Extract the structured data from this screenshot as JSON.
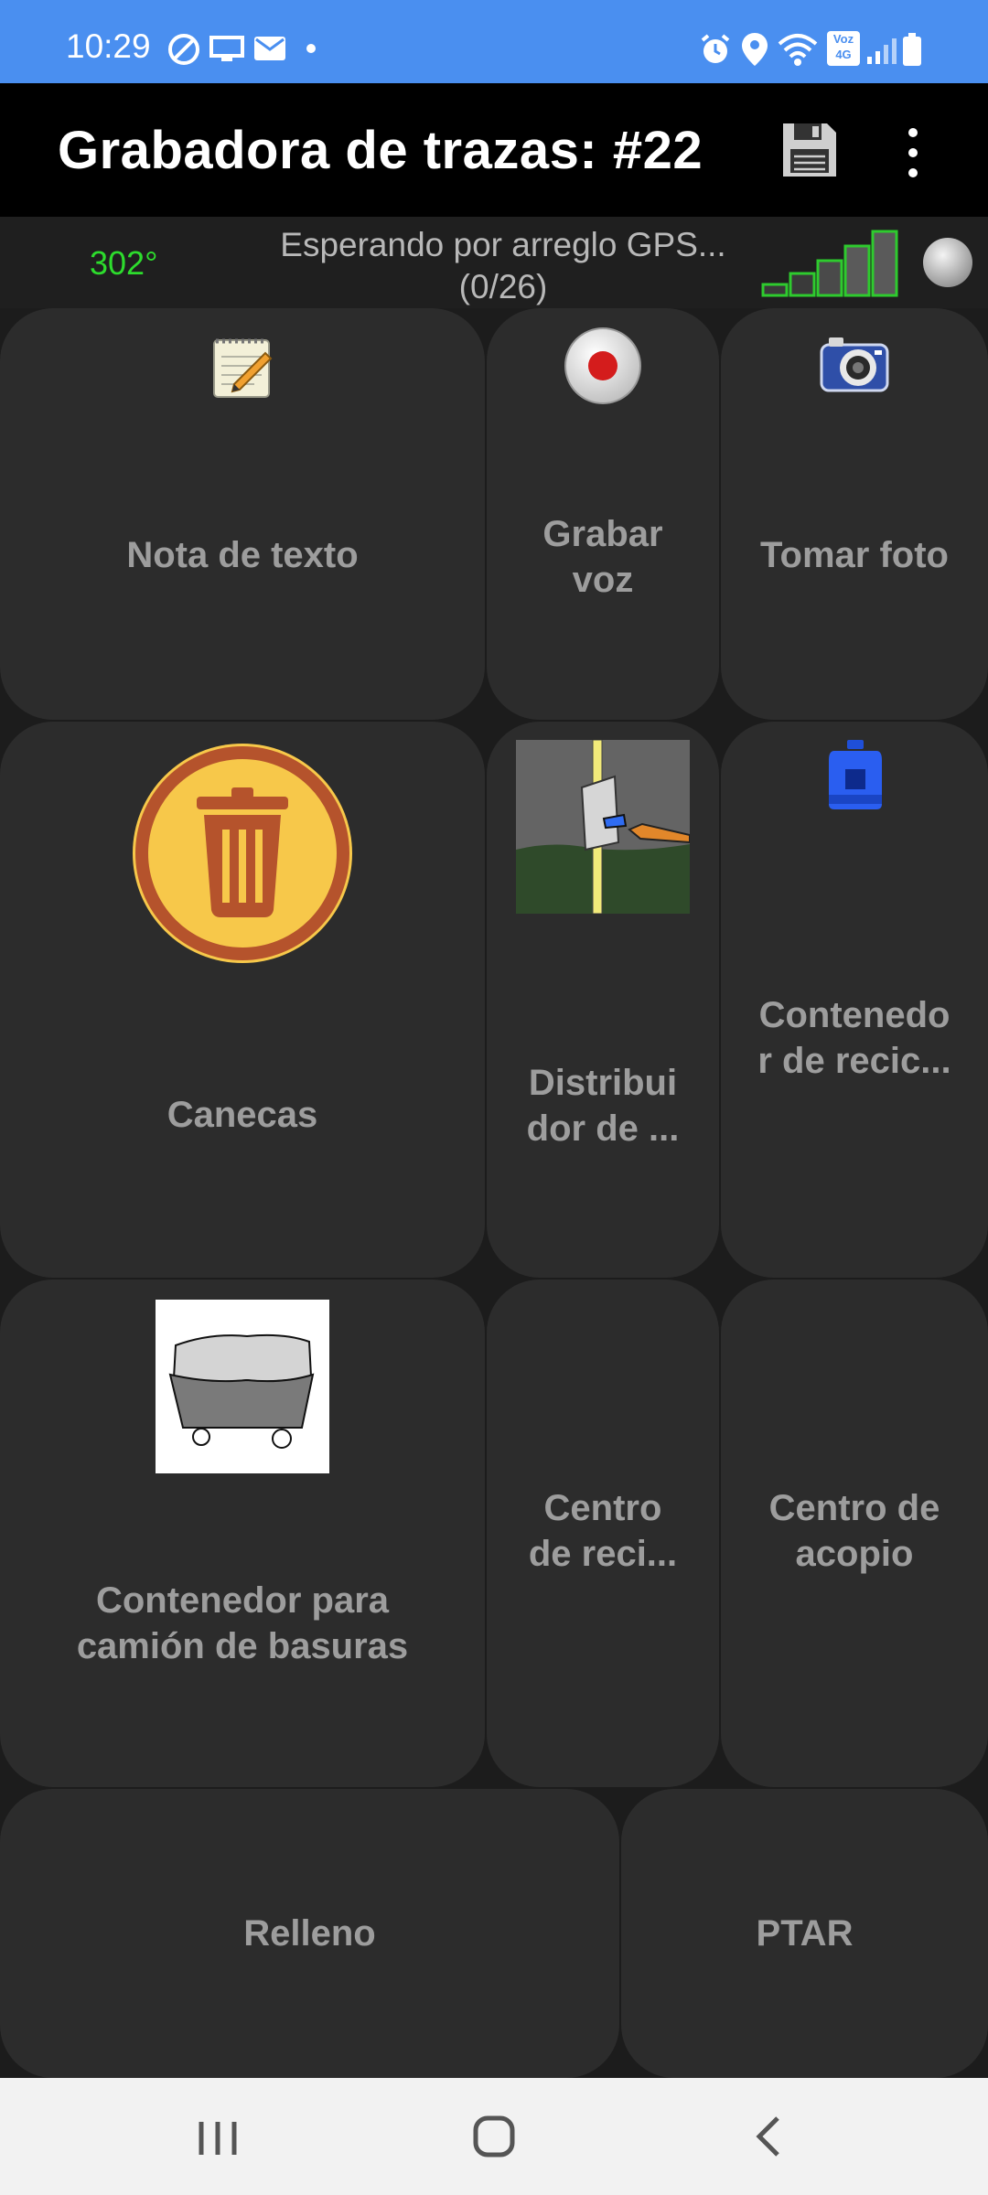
{
  "status_bar": {
    "time": "10:29",
    "left_icons": [
      "missed-call-icon",
      "screen-cast-icon",
      "mail-icon",
      "dot-icon"
    ],
    "right_icons": [
      "alarm-icon",
      "location-icon",
      "wifi-icon",
      "volte-icon",
      "signal-icon",
      "battery-icon"
    ],
    "volte_label": "Voz 4G"
  },
  "app_bar": {
    "title": "Grabadora de trazas: #22",
    "save_icon": "save-icon",
    "more_icon": "more-vert-icon"
  },
  "gps": {
    "heading": "302°",
    "status_line1": "Esperando por arreglo GPS...",
    "status_line2": "(0/26)",
    "signal_icon": "gps-signal-bars-icon",
    "fix_icon": "gps-fix-indicator-icon"
  },
  "tiles": [
    {
      "label": "Nota de texto",
      "icon": "notepad-icon"
    },
    {
      "label_lines": [
        "Grabar",
        "voz"
      ],
      "icon": "record-icon"
    },
    {
      "label": "Tomar foto",
      "icon": "camera-icon"
    },
    {
      "label": "Canecas",
      "icon": "trash-can-icon"
    },
    {
      "label_lines": [
        "Distribui",
        "dor de ..."
      ],
      "icon": "bag-dispenser-icon"
    },
    {
      "label_lines": [
        "Contenedo",
        "r de recic..."
      ],
      "icon": "recycling-bin-icon"
    },
    {
      "label_lines": [
        "Contenedor para",
        "camión de basuras"
      ],
      "icon": "dumpster-icon"
    },
    {
      "label_lines": [
        "Centro",
        "de reci..."
      ]
    },
    {
      "label_lines": [
        "Centro de",
        "acopio"
      ]
    },
    {
      "label": "Relleno"
    },
    {
      "label": "PTAR"
    }
  ],
  "colors": {
    "status_bar": "#4a8ff0",
    "app_bar": "#000000",
    "background": "#1c1c1c",
    "tile": "#2c2c2c",
    "tile_text": "#9d9d9d",
    "heading_text": "#2ddc2d"
  },
  "nav_bar": {
    "recents_icon": "recents-icon",
    "home_icon": "home-icon",
    "back_icon": "back-icon"
  }
}
